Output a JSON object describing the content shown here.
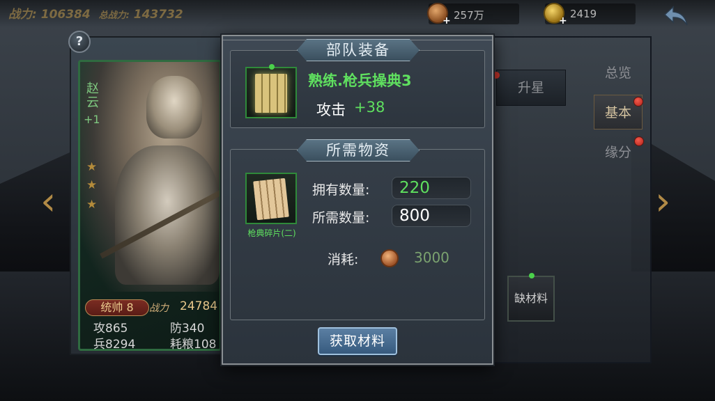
{
  "topbar": {
    "power_label": "战力:",
    "power_value": "106384",
    "total_power_label": "总战力:",
    "total_power_value": "143732",
    "copper": "257万",
    "gold": "2419"
  },
  "hero": {
    "name": "赵云",
    "plus": "+1",
    "rank": "统帅 8",
    "combat_label": "战力",
    "combat_value": "24784",
    "attack": "攻865",
    "defense": "防340",
    "troops": "兵8294",
    "food": "耗粮108"
  },
  "side_tabs": {
    "overview": "总览",
    "basic": "基本",
    "fate": "缘分",
    "star": "升星",
    "lack": "缺材料"
  },
  "modal": {
    "equip_title": "部队装备",
    "equip_name": "熟练.枪兵操典3",
    "stat_label": "攻击",
    "stat_value": "+38",
    "mats_title": "所需物资",
    "frag_name": "枪典碎片(二)",
    "own_label": "拥有数量:",
    "own_value": "220",
    "need_label": "所需数量:",
    "need_value": "800",
    "cost_label": "消耗:",
    "cost_value": "3000",
    "get_button": "获取材料"
  },
  "icons": {
    "help": "?",
    "arrow_left": "‹",
    "arrow_right": "›"
  },
  "colors": {
    "accent_green": "#5fe05f",
    "button_blue": "#4a6f94",
    "gold_text": "#b18a46"
  }
}
